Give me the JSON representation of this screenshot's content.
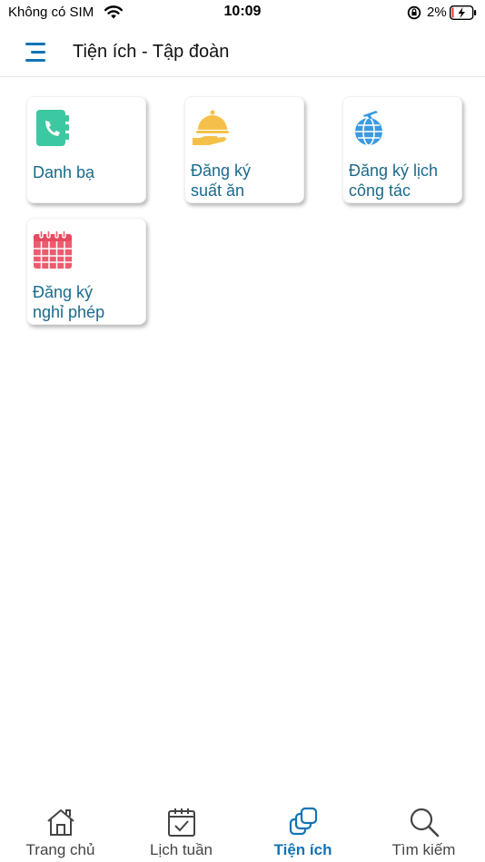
{
  "status_bar": {
    "carrier": "Không có SIM",
    "time": "10:09",
    "battery_percent": "2%"
  },
  "header": {
    "title": "Tiện ích - Tập đoàn",
    "menu_icon": "hamburger-menu-icon"
  },
  "tiles": [
    {
      "label_line1": "Danh bạ",
      "label_line2": "",
      "icon": "address-book-icon",
      "color": "#3cc8a0"
    },
    {
      "label_line1": "Đăng ký",
      "label_line2": "suất ăn",
      "icon": "meal-cloche-icon",
      "color": "#f5c04a"
    },
    {
      "label_line1": "Đăng ký lịch",
      "label_line2": "công tác",
      "icon": "globe-plane-icon",
      "color": "#3b9ae1"
    },
    {
      "label_line1": "Đăng ký",
      "label_line2": "nghỉ phép",
      "icon": "calendar-icon",
      "color": "#ef5b6e"
    }
  ],
  "bottom_nav": {
    "items": [
      {
        "label": "Trang chủ",
        "icon": "home-icon"
      },
      {
        "label": "Lịch tuần",
        "icon": "calendar-check-icon"
      },
      {
        "label": "Tiện ích",
        "icon": "utilities-icon"
      },
      {
        "label": "Tìm kiếm",
        "icon": "search-icon"
      }
    ],
    "active_index": 2
  },
  "colors": {
    "accent": "#1273b5",
    "tile_text": "#1a6a8c"
  }
}
